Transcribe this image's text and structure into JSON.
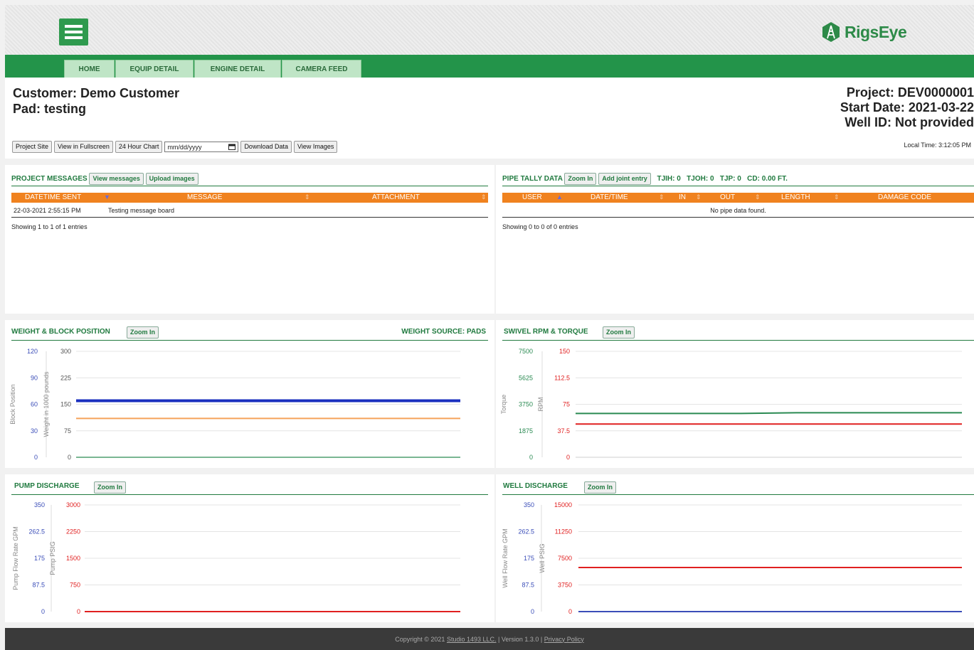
{
  "brand": {
    "name": "RigsEye"
  },
  "tabs": [
    "HOME",
    "EQUIP DETAIL",
    "ENGINE DETAIL",
    "CAMERA FEED"
  ],
  "header": {
    "customer": "Customer: Demo Customer",
    "pad": "Pad: testing",
    "project": "Project: DEV0000001",
    "start_date": "Start Date: 2021-03-22",
    "well_id": "Well ID: Not provided",
    "local_time": "Local Time: 3:12:05 PM"
  },
  "toolbar": {
    "project_site": "Project Site",
    "fullscreen": "View in Fullscreen",
    "chart24": "24 Hour Chart",
    "date_placeholder": "mm/dd/yyyy",
    "download": "Download Data",
    "images": "View Images"
  },
  "messages": {
    "title": "PROJECT MESSAGES",
    "view_btn": "View messages",
    "upload_btn": "Upload images",
    "columns": [
      "DATETIME SENT",
      "MESSAGE",
      "ATTACHMENT"
    ],
    "rows": [
      {
        "datetime": "22-03-2021 2:55:15 PM",
        "message": "Testing message board",
        "attachment": ""
      }
    ],
    "info": "Showing 1 to 1 of 1 entries"
  },
  "pipe": {
    "title": "PIPE TALLY DATA",
    "zoom_btn": "Zoom In",
    "add_btn": "Add joint entry",
    "stats": "TJIH: 0   TJOH: 0   TJP: 0   CD: 0.00 FT.",
    "columns": [
      "USER",
      "DATE/TIME",
      "IN",
      "OUT",
      "LENGTH",
      "DAMAGE CODE"
    ],
    "empty": "No pipe data found.",
    "info": "Showing 0 to 0 of 0 entries"
  },
  "zoom_label": "Zoom In",
  "weight_source": "WEIGHT SOURCE: PADS",
  "footer": {
    "pre": "Copyright © 2021 ",
    "company": "Studio 1493 LLC.",
    "mid": " | Version 1.3.0 | ",
    "privacy": "Privacy Policy"
  },
  "chart_data": [
    {
      "type": "line",
      "title": "WEIGHT & BLOCK POSITION",
      "axes": [
        {
          "label": "Block Position",
          "ticks": [
            "120",
            "90",
            "60",
            "30",
            "0"
          ],
          "color": "#3a4db8",
          "ylim": [
            0,
            120
          ]
        },
        {
          "label": "Weight in 1000 pounds",
          "ticks": [
            "300",
            "225",
            "150",
            "75",
            "0"
          ],
          "color": "#555555",
          "ylim": [
            0,
            300
          ]
        }
      ],
      "series": [
        {
          "color": "#1a2fbf",
          "axis": 1,
          "values": [
            160,
            160
          ]
        },
        {
          "color": "#f5a35a",
          "axis": 1,
          "values": [
            110,
            110
          ]
        },
        {
          "color": "#2a8a52",
          "axis": 1,
          "values": [
            0,
            0
          ]
        }
      ]
    },
    {
      "type": "line",
      "title": "SWIVEL RPM & TORQUE",
      "axes": [
        {
          "label": "Torque",
          "ticks": [
            "7500",
            "5625",
            "3750",
            "1875",
            "0"
          ],
          "color": "#2a8a52",
          "ylim": [
            0,
            7500
          ]
        },
        {
          "label": "RPM",
          "ticks": [
            "150",
            "112.5",
            "75",
            "37.5",
            "0"
          ],
          "color": "#e02020",
          "ylim": [
            0,
            150
          ]
        }
      ],
      "series": [
        {
          "color": "#2a8a52",
          "axis": 0,
          "values": [
            3100,
            3100,
            3100,
            3100,
            3150,
            3150,
            3150,
            3150
          ]
        },
        {
          "color": "#e02020",
          "axis": 1,
          "values": [
            47,
            47
          ]
        }
      ]
    },
    {
      "type": "line",
      "title": "PUMP DISCHARGE",
      "axes": [
        {
          "label": "Pump Flow Rate GPM",
          "ticks": [
            "350",
            "262.5",
            "175",
            "87.5",
            "0"
          ],
          "color": "#3a4db8",
          "ylim": [
            0,
            350
          ]
        },
        {
          "label": "Pump PSIG",
          "ticks": [
            "3000",
            "2250",
            "1500",
            "750",
            "0"
          ],
          "color": "#e02020",
          "ylim": [
            0,
            3000
          ]
        }
      ],
      "series": [
        {
          "color": "#e02020",
          "axis": 1,
          "values": [
            0,
            0
          ]
        }
      ]
    },
    {
      "type": "line",
      "title": "WELL DISCHARGE",
      "axes": [
        {
          "label": "Well Flow Rate GPM",
          "ticks": [
            "350",
            "262.5",
            "175",
            "87.5",
            "0"
          ],
          "color": "#3a4db8",
          "ylim": [
            0,
            350
          ]
        },
        {
          "label": "Well PSIG",
          "ticks": [
            "15000",
            "11250",
            "7500",
            "3750",
            "0"
          ],
          "color": "#e02020",
          "ylim": [
            0,
            15000
          ]
        }
      ],
      "series": [
        {
          "color": "#e02020",
          "axis": 1,
          "values": [
            6200,
            6200
          ]
        },
        {
          "color": "#3a4db8",
          "axis": 0,
          "values": [
            0,
            0
          ]
        }
      ]
    }
  ]
}
